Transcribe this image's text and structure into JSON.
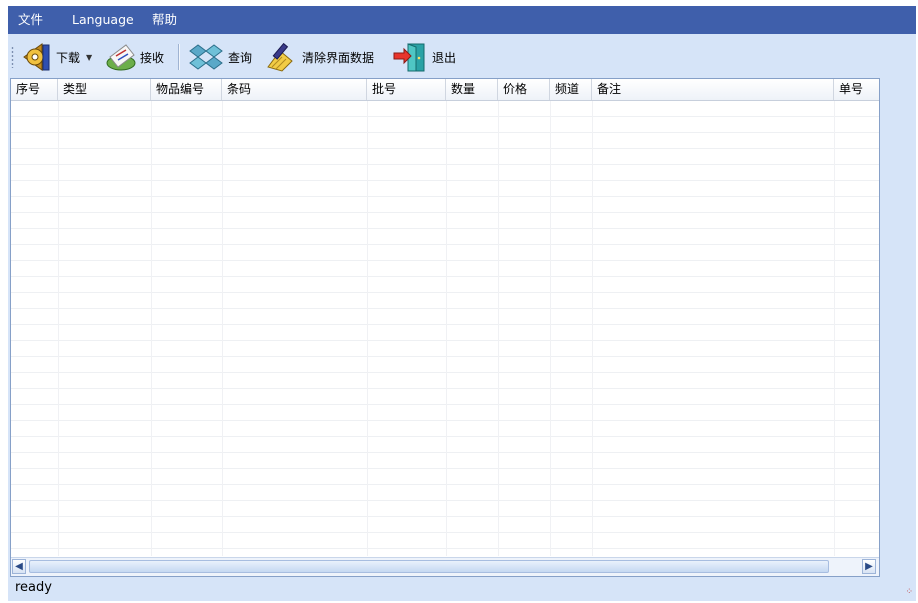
{
  "menu": {
    "items": [
      {
        "label": "文件"
      },
      {
        "label": "Language"
      },
      {
        "label": "帮助"
      }
    ]
  },
  "toolbar": {
    "download_label": "下载",
    "receive_label": "接收",
    "query_label": "查询",
    "clear_label": "清除界面数据",
    "exit_label": "退出"
  },
  "grid": {
    "columns": [
      "序号",
      "类型",
      "物品编号",
      "条码",
      "批号",
      "数量",
      "价格",
      "频道",
      "备注",
      "单号"
    ],
    "rows": []
  },
  "status": {
    "text": "ready"
  },
  "colors": {
    "menubar": "#3f5fab",
    "toolbar": "#d6e4f8",
    "grid_border": "#86a0c8"
  }
}
